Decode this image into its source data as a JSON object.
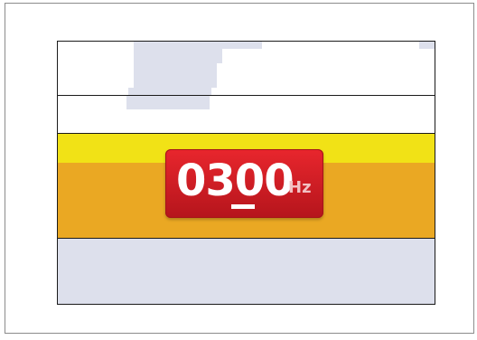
{
  "display": {
    "frequency_value": "0300",
    "frequency_unit": "Hz",
    "cursor_digit_index": 2
  },
  "colors": {
    "frequency_box": "#d81e25",
    "upper_band": "#f1e216",
    "lower_band": "#eaa823",
    "background_region": "#dde0ec"
  }
}
